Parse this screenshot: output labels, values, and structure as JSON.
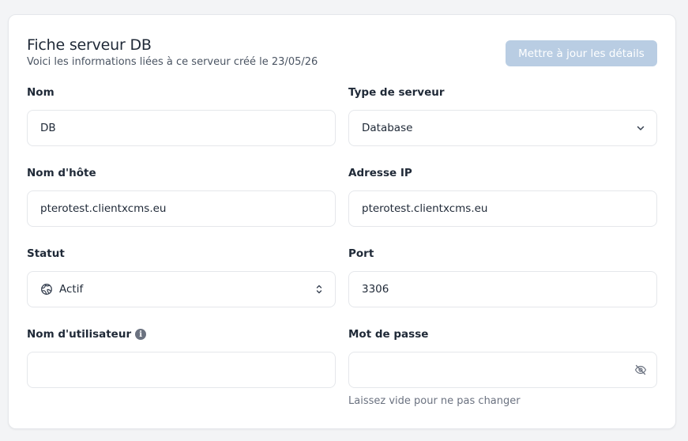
{
  "header": {
    "title": "Fiche serveur DB",
    "subtitle": "Voici les informations liées à ce serveur créé le 23/05/26",
    "update_button": "Mettre à jour les détails"
  },
  "form": {
    "name": {
      "label": "Nom",
      "value": "DB"
    },
    "server_type": {
      "label": "Type de serveur",
      "value": "Database"
    },
    "hostname": {
      "label": "Nom d'hôte",
      "value": "pterotest.clientxcms.eu"
    },
    "ip_address": {
      "label": "Adresse IP",
      "value": "pterotest.clientxcms.eu"
    },
    "status": {
      "label": "Statut",
      "value": "Actif",
      "icon": "globe-icon"
    },
    "port": {
      "label": "Port",
      "value": "3306"
    },
    "username": {
      "label": "Nom d'utilisateur",
      "value": "",
      "info_icon": "info-icon"
    },
    "password": {
      "label": "Mot de passe",
      "value": "",
      "hint": "Laissez vide pour ne pas changer",
      "icon": "eye-slash-icon"
    }
  },
  "colors": {
    "button_bg": "#b9cde3",
    "border": "#e5e7eb",
    "text": "#1f2937",
    "muted": "#6b7280"
  }
}
